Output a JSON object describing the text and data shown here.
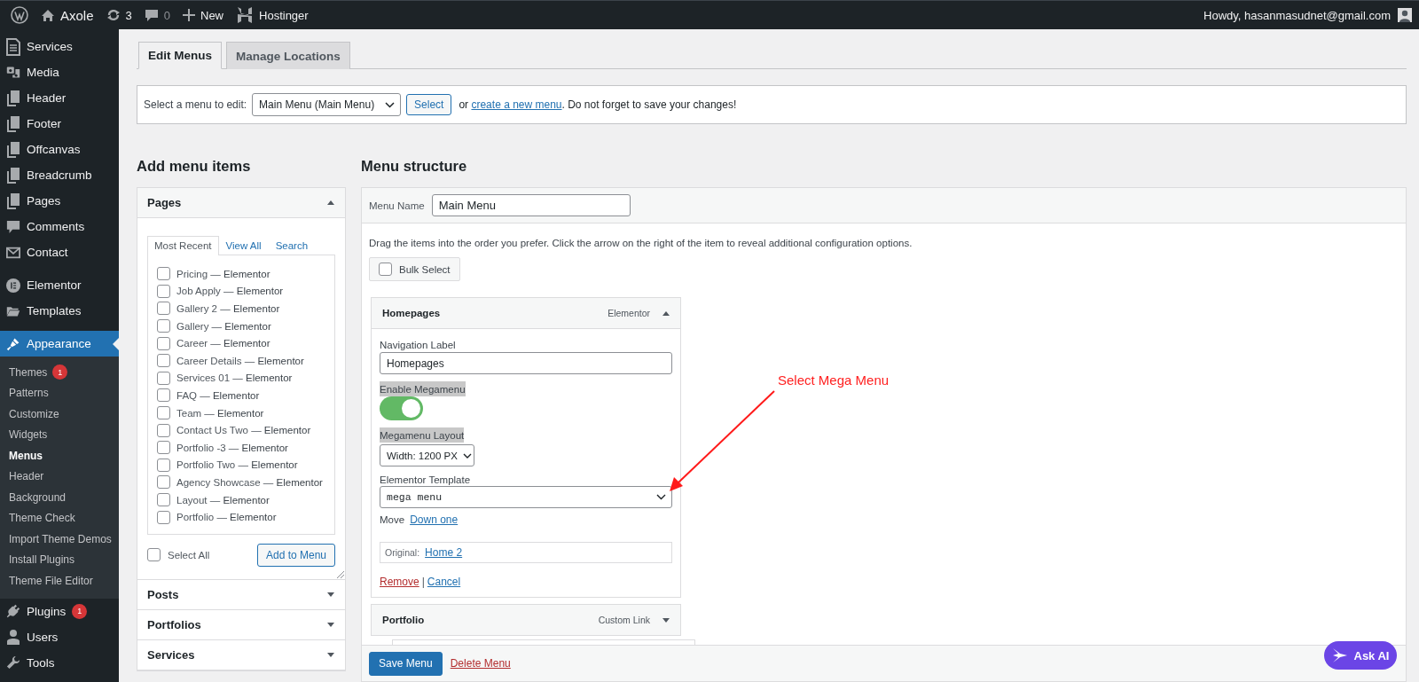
{
  "admin_bar": {
    "site_name": "Axole",
    "updates": "3",
    "comments": "0",
    "new": "New",
    "hosting": "Hostinger",
    "greeting": "Howdy, hasanmasudnet@gmail.com"
  },
  "sidebar": {
    "groups": [
      [
        {
          "label": "Services",
          "selected": false
        },
        {
          "label": "Media",
          "selected": false
        },
        {
          "label": "Header",
          "selected": false
        },
        {
          "label": "Footer",
          "selected": false
        },
        {
          "label": "Offcanvas",
          "selected": false
        },
        {
          "label": "Breadcrumb",
          "selected": false
        },
        {
          "label": "Pages",
          "selected": false
        },
        {
          "label": "Comments",
          "selected": false
        },
        {
          "label": "Contact",
          "selected": false
        }
      ],
      [
        {
          "label": "Elementor",
          "selected": false
        },
        {
          "label": "Templates",
          "selected": false
        }
      ],
      [
        {
          "label": "Appearance",
          "selected": true,
          "children": [
            {
              "label": "Themes",
              "selected": false,
              "badge": "1"
            },
            {
              "label": "Patterns",
              "selected": false
            },
            {
              "label": "Customize",
              "selected": false
            },
            {
              "label": "Widgets",
              "selected": false
            },
            {
              "label": "Menus",
              "selected": true
            },
            {
              "label": "Header",
              "selected": false
            },
            {
              "label": "Background",
              "selected": false
            },
            {
              "label": "Theme Check",
              "selected": false
            },
            {
              "label": "Import Theme Demos",
              "selected": false
            },
            {
              "label": "Install Plugins",
              "selected": false
            },
            {
              "label": "Theme File Editor",
              "selected": false
            }
          ]
        },
        {
          "label": "Plugins",
          "selected": false,
          "badge": "1"
        },
        {
          "label": "Users",
          "selected": false
        },
        {
          "label": "Tools",
          "selected": false
        }
      ]
    ]
  },
  "tabs": [
    {
      "label": "Edit Menus",
      "selected": true
    },
    {
      "label": "Manage Locations",
      "selected": false
    }
  ],
  "menu_select": {
    "label": "Select a menu to edit:",
    "value": "Main Menu (Main Menu)",
    "button": "Select",
    "text_before": "or",
    "link": "create a new menu",
    "text_after": ". Do not forget to save your changes!"
  },
  "add_items": {
    "heading": "Add menu items",
    "sections": [
      {
        "title": "Pages",
        "expanded": true,
        "tabs": [
          {
            "label": "Most Recent",
            "selected": true
          },
          {
            "label": "View All",
            "selected": false
          },
          {
            "label": "Search",
            "selected": false
          }
        ],
        "pages": [
          {
            "label": "Pricing — **Elementor**",
            "checked": false
          },
          {
            "label": "Job Apply — **Elementor**",
            "checked": false
          },
          {
            "label": "Gallery 2 — **Elementor**",
            "checked": false
          },
          {
            "label": "Gallery — **Elementor**",
            "checked": false
          },
          {
            "label": "Career — **Elementor**",
            "checked": false
          },
          {
            "label": "Career Details — **Elementor**",
            "checked": false
          },
          {
            "label": "Services 01 — **Elementor**",
            "checked": false
          },
          {
            "label": "FAQ — **Elementor**",
            "checked": false
          },
          {
            "label": "Team — **Elementor**",
            "checked": false
          },
          {
            "label": "Contact Us Two — **Elementor**",
            "checked": false
          },
          {
            "label": "Portfolio -3 — **Elementor**",
            "checked": false
          },
          {
            "label": "Portfolio Two — **Elementor**",
            "checked": false
          },
          {
            "label": "Agency Showcase — **Elementor**",
            "checked": false
          },
          {
            "label": "Layout — **Elementor**",
            "checked": false
          },
          {
            "label": "Portfolio — **Elementor**",
            "checked": false
          }
        ],
        "select_all": {
          "label": "Select All",
          "checked": false
        },
        "add_button": "Add to Menu"
      },
      {
        "title": "Posts",
        "expanded": false
      },
      {
        "title": "Portfolios",
        "expanded": false
      },
      {
        "title": "Services",
        "expanded": false
      }
    ]
  },
  "menu_structure": {
    "heading": "Menu structure",
    "name_label": "Menu Name",
    "name_value": "Main Menu",
    "instructions": "Drag the items into the order you prefer. Click the arrow on the right of the item to reveal additional configuration options.",
    "bulk_select": {
      "label": "Bulk Select",
      "checked": false
    },
    "items": [
      {
        "title": "Homepages",
        "type": "Elementor",
        "expanded": true,
        "settings": {
          "nav_label_caption": "Navigation Label",
          "nav_label_value": "Homepages",
          "megamenu_caption": "Enable Megamenu",
          "megamenu_on": true,
          "layout_caption": "Megamenu Layout",
          "layout_value": "Width: 1200 PX",
          "template_caption": "Elementor Template",
          "template_value": "mega menu",
          "move_label": "Move",
          "move_link": "Down one",
          "original_label": "Original:",
          "original_link": "Home 2",
          "remove": "Remove",
          "separator": "|",
          "cancel": "Cancel"
        }
      },
      {
        "title": "Portfolio",
        "type": "Custom Link",
        "expanded": false
      }
    ],
    "save_button": "Save Menu",
    "delete_link": "Delete Menu"
  },
  "annotation": {
    "text": "Select Mega Menu"
  },
  "ask_ai": {
    "label": "Ask AI"
  }
}
